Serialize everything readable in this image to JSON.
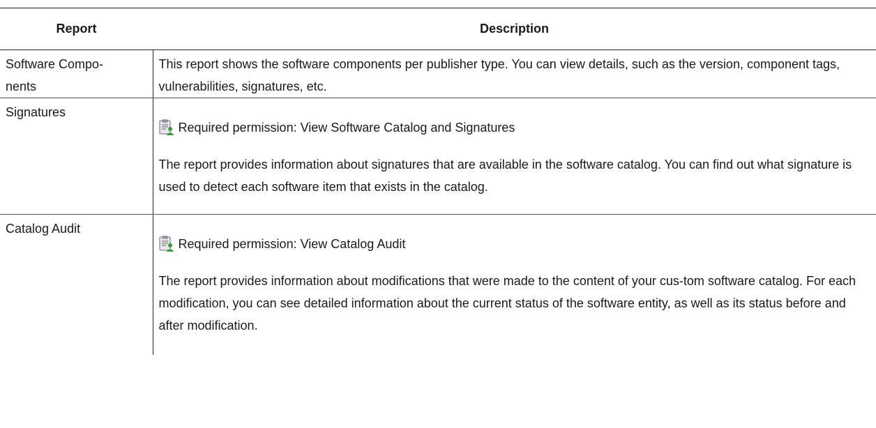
{
  "table": {
    "headers": {
      "report": "Report",
      "description": "Description"
    },
    "rows": [
      {
        "report_line1": "Software Compo-",
        "report_line2": "nents",
        "description": "This report shows the software components per publisher type. You can view details, such as the version, component tags, vulnerabilities, signatures, etc."
      },
      {
        "report": "Signatures",
        "permission": "Required permission: View Software Catalog and Signatures",
        "description": "The report provides information about signatures that are available in the software catalog. You can find out what signature is used to detect each software item that exists in the catalog."
      },
      {
        "report": "Catalog Audit",
        "permission": "Required permission: View Catalog Audit",
        "description": "The report provides information about modifications that were made to the content of your cus-tom software catalog. For each modification, you can see detailed information about the current status of the software entity, as well as its status before and after modification."
      }
    ]
  },
  "icons": {
    "permission_icon": "clipboard-user-icon"
  },
  "colors": {
    "icon_clipboard": "#8a8f99",
    "icon_user": "#3c9a3c"
  }
}
